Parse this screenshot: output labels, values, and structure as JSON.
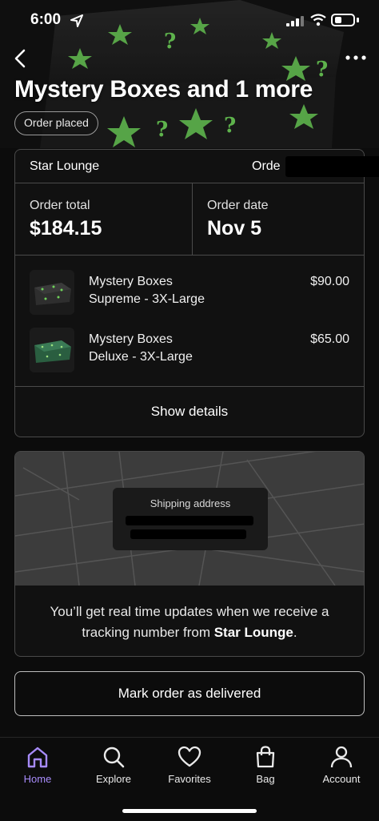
{
  "status_bar": {
    "time": "6:00"
  },
  "header": {
    "title": "Mystery Boxes and 1 more",
    "status_badge": "Order placed"
  },
  "order": {
    "shop_name": "Star Lounge",
    "order_label": "Orde",
    "total_label": "Order total",
    "total_value": "$184.15",
    "date_label": "Order date",
    "date_value": "Nov 5",
    "items": [
      {
        "name": "Mystery Boxes",
        "variant": "Supreme - 3X-Large",
        "price": "$90.00",
        "thumb_color": "#3b3b3b"
      },
      {
        "name": "Mystery Boxes",
        "variant": "Deluxe - 3X-Large",
        "price": "$65.00",
        "thumb_color": "#2f6b4a"
      }
    ],
    "show_details_label": "Show details"
  },
  "shipping": {
    "label": "Shipping address",
    "message_prefix": "You’ll get real time updates when we receive a tracking number from ",
    "message_shop": "Star Lounge",
    "message_suffix": "."
  },
  "actions": {
    "mark_delivered_label": "Mark order as delivered"
  },
  "tabbar": {
    "tabs": [
      {
        "label": "Home",
        "icon": "home-icon",
        "active": true
      },
      {
        "label": "Explore",
        "icon": "search-icon",
        "active": false
      },
      {
        "label": "Favorites",
        "icon": "heart-icon",
        "active": false
      },
      {
        "label": "Bag",
        "icon": "bag-icon",
        "active": false
      },
      {
        "label": "Account",
        "icon": "account-icon",
        "active": false
      }
    ]
  },
  "colors": {
    "accent": "#a78bfa",
    "star_green": "#6fd35a",
    "background": "#0c0c0c"
  }
}
